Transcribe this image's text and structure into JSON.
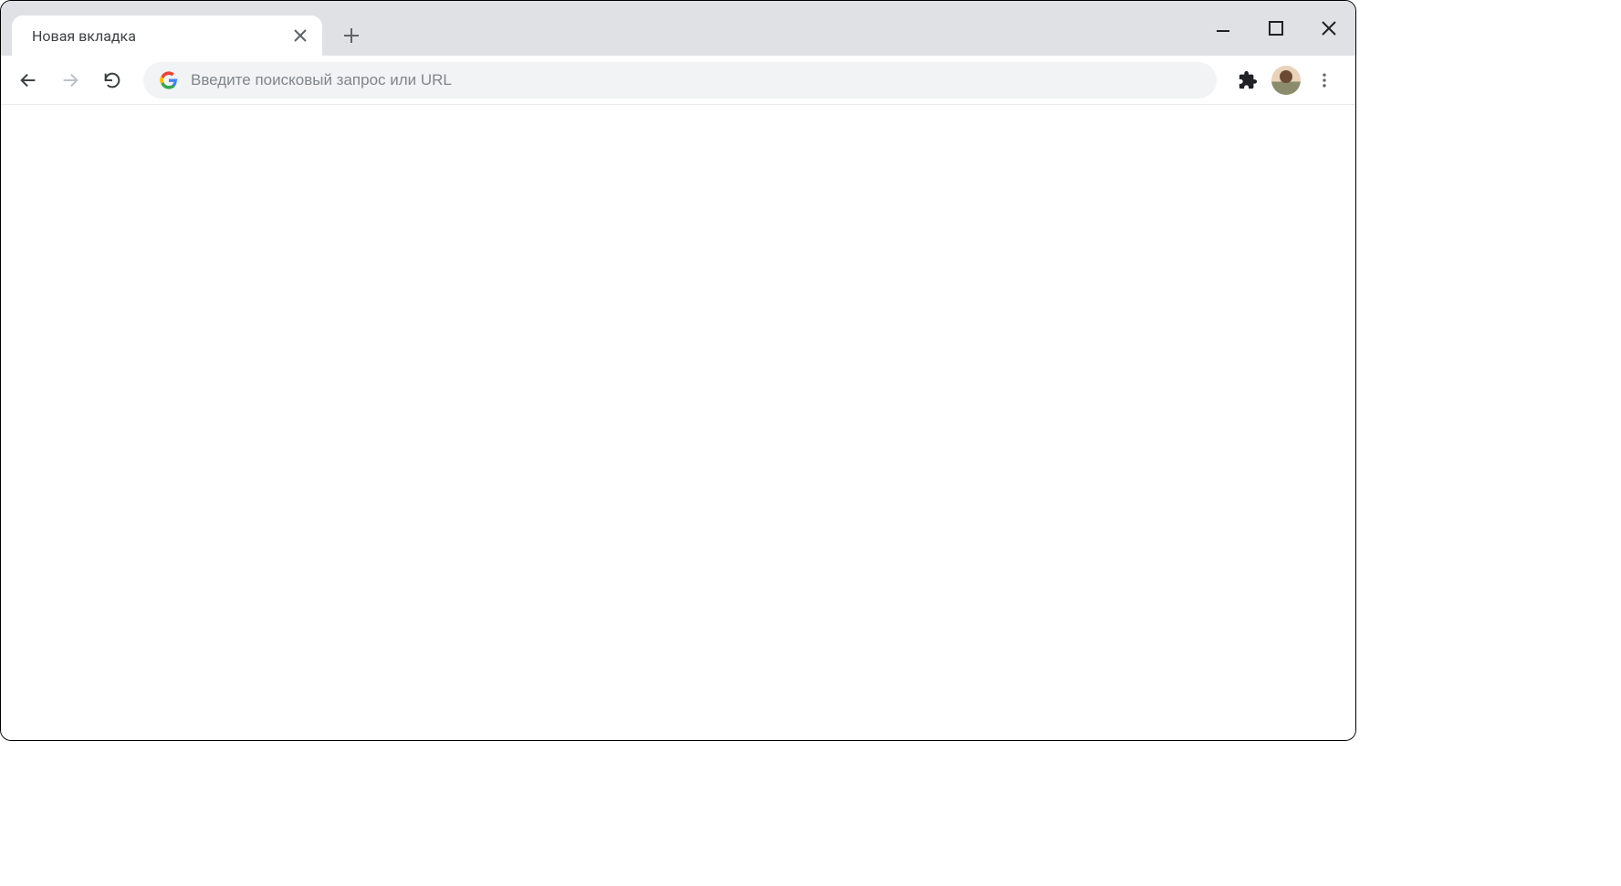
{
  "tab": {
    "title": "Новая вкладка"
  },
  "omnibox": {
    "placeholder": "Введите поисковый запрос или URL",
    "value": ""
  },
  "icons": {
    "google": "google-logo-icon",
    "extensions": "puzzle-piece-icon",
    "menu": "vertical-dots-icon"
  }
}
